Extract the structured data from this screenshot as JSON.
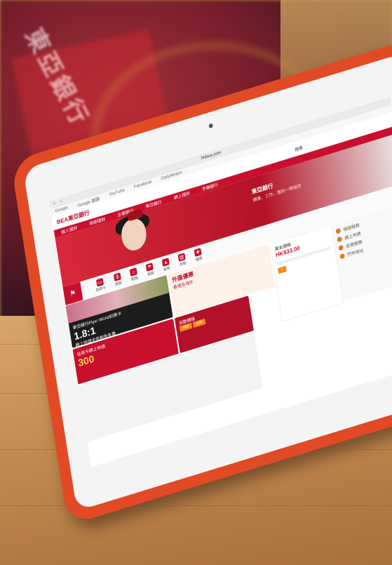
{
  "photo": {
    "background_sign": "東亞銀行",
    "colors": {
      "tablet_case": "#e24a26",
      "brand_red": "#c8102e",
      "table_wood": "#c48d52",
      "accent_orange": "#f08a1c"
    }
  },
  "browser": {
    "url": "hkbea.com",
    "bookmarks": [
      "Google",
      "Google 翻譯",
      "YouTube",
      "Facebook",
      "DailyMotion"
    ]
  },
  "site": {
    "logo": "BEA東亞銀行",
    "search_label": "搜尋",
    "nav": [
      "個人理財",
      "商務理財",
      "企業銀行",
      "東亞銀行",
      "網上理財",
      "手機銀行"
    ],
    "hero_title": "東亞銀行",
    "hero_sub": "讀書、工作、理財一齊搞定",
    "icons": [
      {
        "name": "cards",
        "label": "信用卡"
      },
      {
        "name": "loans",
        "label": "貸款"
      },
      {
        "name": "home",
        "label": "按揭"
      },
      {
        "name": "insurance",
        "label": "保險"
      },
      {
        "name": "wealth",
        "label": "投資"
      },
      {
        "name": "bank",
        "label": "存款"
      },
      {
        "name": "gift",
        "label": "優惠"
      }
    ],
    "promos": {
      "black_card": {
        "line1": "東亞銀行Flyer World扣賬卡",
        "rate": "1.8:1",
        "line2": "網上申請全年豁免年費"
      },
      "red_left": {
        "text": "信用卡網上申請",
        "amount": "300"
      },
      "red_mid": {
        "text": "自動轉賬",
        "amount": "800",
        "amount2": "100"
      },
      "center": {
        "line1": "外匯優惠",
        "line2": "香港及海外"
      },
      "price": {
        "label": "黃金價格",
        "value": "HK$33.00"
      },
      "list": [
        "保險服務",
        "網上申請",
        "投資服務",
        "門市地址"
      ]
    }
  }
}
